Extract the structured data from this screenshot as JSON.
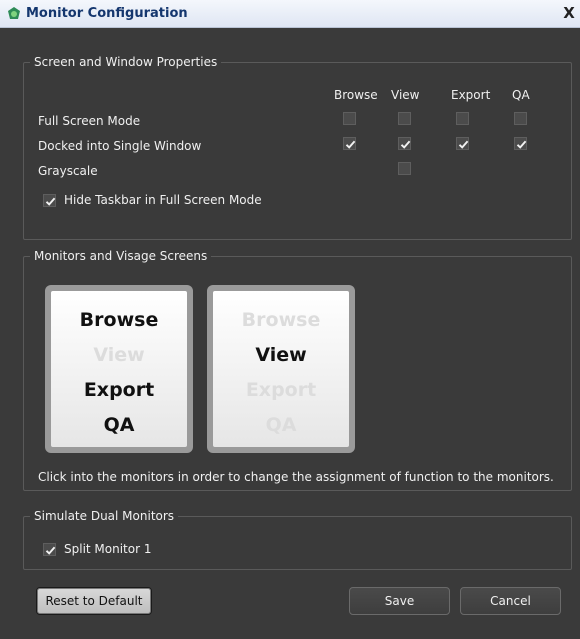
{
  "window": {
    "title": "Monitor Configuration",
    "close_glyph": "X",
    "icon": "app-logo-icon"
  },
  "screen_props": {
    "title": "Screen and Window Properties",
    "columns": [
      "Browse",
      "View",
      "Export",
      "QA"
    ],
    "rows": [
      {
        "label": "Full Screen Mode",
        "checks": [
          false,
          false,
          false,
          false
        ]
      },
      {
        "label": "Docked into Single Window",
        "checks": [
          true,
          true,
          true,
          true
        ]
      },
      {
        "label": "Grayscale",
        "checks": [
          null,
          false,
          null,
          null
        ]
      }
    ],
    "hide_taskbar": {
      "label": "Hide Taskbar in Full Screen Mode",
      "checked": true
    }
  },
  "monitors": {
    "title": "Monitors and Visage Screens",
    "screens": [
      {
        "functions": [
          {
            "label": "Browse",
            "active": true
          },
          {
            "label": "View",
            "active": false
          },
          {
            "label": "Export",
            "active": true
          },
          {
            "label": "QA",
            "active": true
          }
        ]
      },
      {
        "functions": [
          {
            "label": "Browse",
            "active": false
          },
          {
            "label": "View",
            "active": true
          },
          {
            "label": "Export",
            "active": false
          },
          {
            "label": "QA",
            "active": false
          }
        ]
      }
    ],
    "hint": "Click into the monitors in order to change the assignment of function to the monitors."
  },
  "simulate": {
    "title": "Simulate Dual Monitors",
    "split": {
      "label": "Split Monitor 1",
      "checked": true
    }
  },
  "buttons": {
    "reset": "Reset to Default",
    "save": "Save",
    "cancel": "Cancel"
  }
}
